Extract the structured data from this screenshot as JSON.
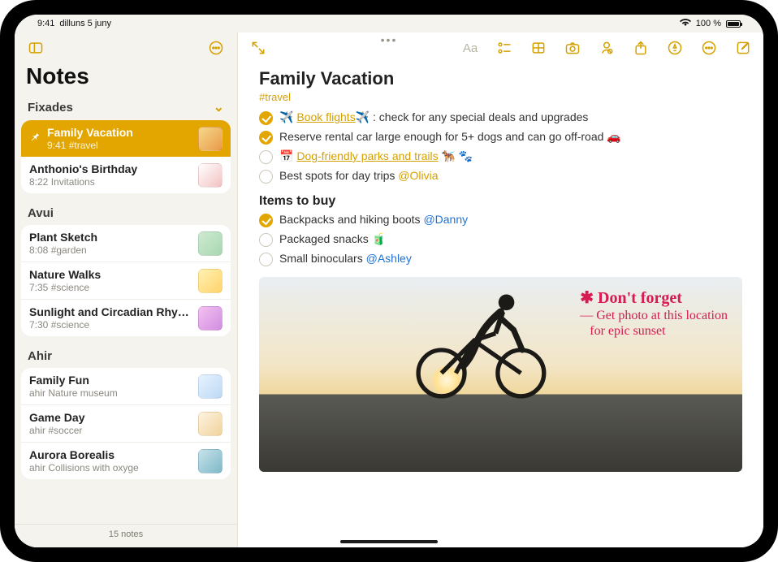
{
  "status": {
    "time": "9:41",
    "date": "dilluns 5 juny",
    "battery": "100 %"
  },
  "sidebar": {
    "title": "Notes",
    "footer": "15 notes",
    "sections": [
      {
        "header": "Fixades",
        "collapsible": true,
        "items": [
          {
            "title": "Family Vacation",
            "sub": "9:41  #travel",
            "selected": true,
            "pinned": true
          },
          {
            "title": "Anthonio's Birthday",
            "sub": "8:22  Invitations"
          }
        ]
      },
      {
        "header": "Avui",
        "items": [
          {
            "title": "Plant Sketch",
            "sub": "8:08  #garden"
          },
          {
            "title": "Nature Walks",
            "sub": "7:35  #science"
          },
          {
            "title": "Sunlight and Circadian Rhy…",
            "sub": "7:30  #science"
          }
        ]
      },
      {
        "header": "Ahir",
        "items": [
          {
            "title": "Family Fun",
            "sub": "ahir  Nature museum"
          },
          {
            "title": "Game Day",
            "sub": "ahir  #soccer"
          },
          {
            "title": "Aurora Borealis",
            "sub": "ahir  Collisions with oxyge"
          }
        ]
      }
    ]
  },
  "note": {
    "title": "Family Vacation",
    "tag": "#travel",
    "checklist1": [
      {
        "checked": true,
        "pre": "✈️ ",
        "link": "Book flights",
        "post": "✈️ : check for any special deals and upgrades"
      },
      {
        "checked": true,
        "text": "Reserve rental car large enough for 5+ dogs and can go off-road 🚗"
      },
      {
        "checked": false,
        "pre": "📅 ",
        "link": "Dog-friendly parks and trails",
        "post": " 🐕‍🦺 🐾"
      },
      {
        "checked": false,
        "text": "Best spots for day trips ",
        "mention": "@Olivia",
        "mention_style": "o"
      }
    ],
    "subhead": "Items to buy",
    "checklist2": [
      {
        "checked": true,
        "text": "Backpacks and hiking boots ",
        "mention": "@Danny",
        "mention_style": "b"
      },
      {
        "checked": false,
        "text": "Packaged snacks 🧃"
      },
      {
        "checked": false,
        "text": "Small binoculars ",
        "mention": "@Ashley",
        "mention_style": "b"
      }
    ],
    "handwriting": {
      "line1": "✱ Don't forget",
      "line2": "— Get photo at this location",
      "line3": "for epic sunset"
    }
  }
}
